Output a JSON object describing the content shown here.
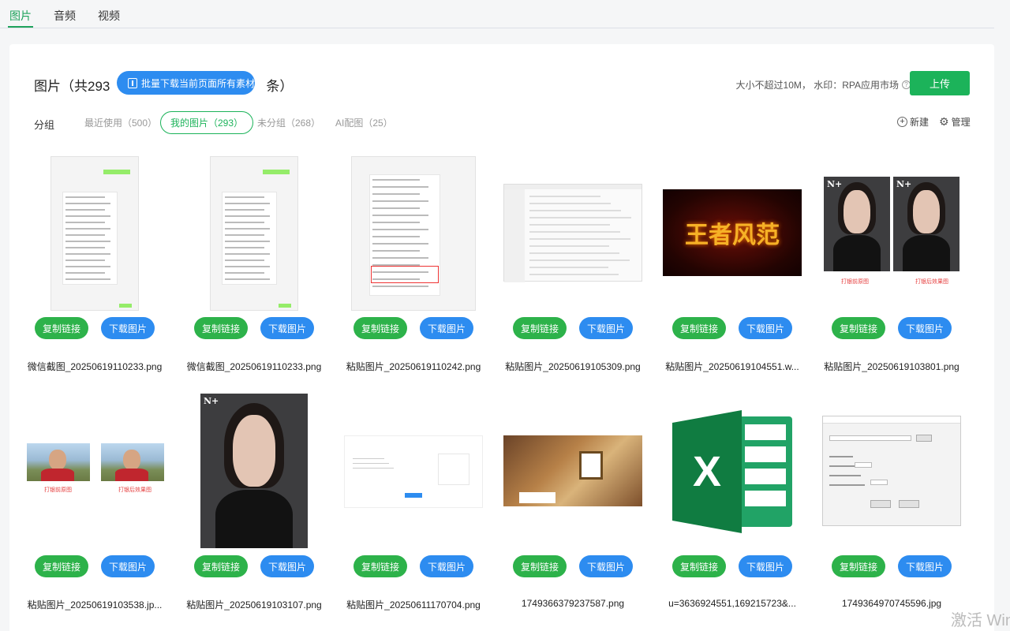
{
  "top_tabs": [
    "图片",
    "音频",
    "视频"
  ],
  "header": {
    "title_prefix": "图片（共293",
    "title_suffix": "条）",
    "bulk_download_label": "批量下载当前页面所有素材",
    "hint": "大小不超过10M， 水印：RPA应用市场",
    "upload_label": "上传"
  },
  "groups": {
    "label": "分组",
    "tabs": [
      {
        "label": "最近使用（500）",
        "active": false
      },
      {
        "label": "我的图片（293）",
        "active": true
      },
      {
        "label": "未分组（268）",
        "active": false
      },
      {
        "label": "AI配图（25）",
        "active": false
      }
    ],
    "new_label": "新建",
    "manage_label": "管理"
  },
  "card_actions": {
    "copy": "复制链接",
    "download": "下载图片"
  },
  "images": [
    {
      "name": "微信截图_20250619110233.png",
      "kind": "chat"
    },
    {
      "name": "微信截图_20250619110233.png",
      "kind": "chat"
    },
    {
      "name": "粘贴图片_20250619110242.png",
      "kind": "chat-wide"
    },
    {
      "name": "粘贴图片_20250619105309.png",
      "kind": "winapp"
    },
    {
      "name": "粘贴图片_20250619104551.w...",
      "kind": "game",
      "logo_text": "王者风范"
    },
    {
      "name": "粘贴图片_20250619103801.png",
      "kind": "portrait-pair",
      "captions": [
        "打银前原图",
        "打银后效果图"
      ],
      "mark": "N+"
    },
    {
      "name": "粘贴图片_20250619103538.jp...",
      "kind": "outdoor-pair",
      "captions": [
        "打银前原图",
        "打银后效果图"
      ]
    },
    {
      "name": "粘贴图片_20250619103107.png",
      "kind": "portrait",
      "mark": "N+"
    },
    {
      "name": "粘贴图片_20250611170704.png",
      "kind": "web"
    },
    {
      "name": "1749366379237587.png",
      "kind": "food"
    },
    {
      "name": "u=3636924551,169215723&...",
      "kind": "excel",
      "letter": "X"
    },
    {
      "name": "1749364970745596.jpg",
      "kind": "dialog"
    }
  ],
  "watermark": "激活 Win"
}
